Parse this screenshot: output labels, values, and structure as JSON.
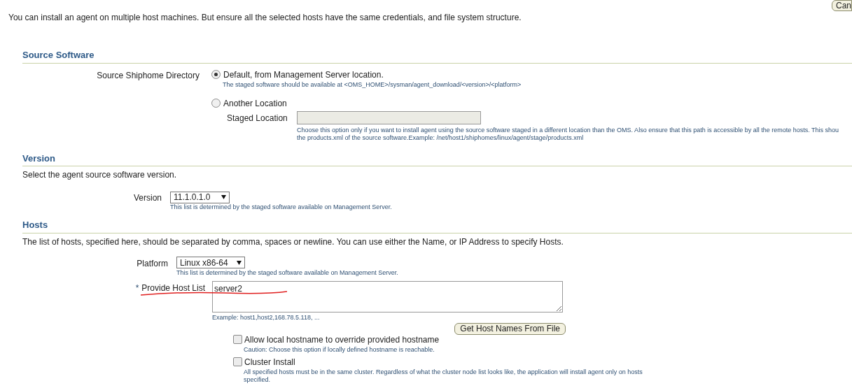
{
  "cancel_button": "Can",
  "intro": "You can install an agent on multiple host machines. But ensure all the selected hosts have the same credentials, and file system structure.",
  "source_software": {
    "heading": "Source Software",
    "label": "Source Shiphome Directory",
    "options": [
      {
        "label": "Default, from Management Server location.",
        "selected": true,
        "hint": "The staged software should be available at <OMS_HOME>/sysman/agent_download/<version>/<platform>"
      },
      {
        "label": "Another Location",
        "selected": false
      }
    ],
    "staged_location": {
      "label": "Staged Location",
      "disabled": true,
      "hint_lines": [
        "Choose this option only if you want to install agent using the source software staged in a different location than the OMS. Also ensure that this path is accessible by all the remote hosts. This shou",
        "the products.xml of the source software.Example: /net/host1/shiphomes/linux/agent/stage/products.xml"
      ]
    }
  },
  "version": {
    "heading": "Version",
    "description": "Select the agent source software version.",
    "label": "Version",
    "value": "11.1.0.1.0",
    "hint": "This list is determined by the staged software available on Management Server."
  },
  "hosts": {
    "heading": "Hosts",
    "description": "The list of hosts, specified here, should be separated by comma, spaces or newline. You can use either the Name, or IP Address to specify Hosts.",
    "platform": {
      "label": "Platform",
      "value": "Linux x86-64",
      "hint": "This list is determined by the staged software available on Management Server."
    },
    "host_list": {
      "required_mark": "*",
      "label": "Provide Host List",
      "value": "server2",
      "hint": "Example: host1,host2,168.78.5.118, ..."
    },
    "get_host_names_button": "Get Host Names From File",
    "options": [
      {
        "label": "Allow local hostname to override provided hostname",
        "checked": false,
        "hint": "Caution: Choose this option if locally defined hostname is reachable."
      },
      {
        "label": "Cluster Install",
        "checked": false,
        "hint": "All specified hosts must be in the same cluster. Regardless of what the cluster node list looks like, the application will install agent only on hosts specified."
      }
    ]
  }
}
